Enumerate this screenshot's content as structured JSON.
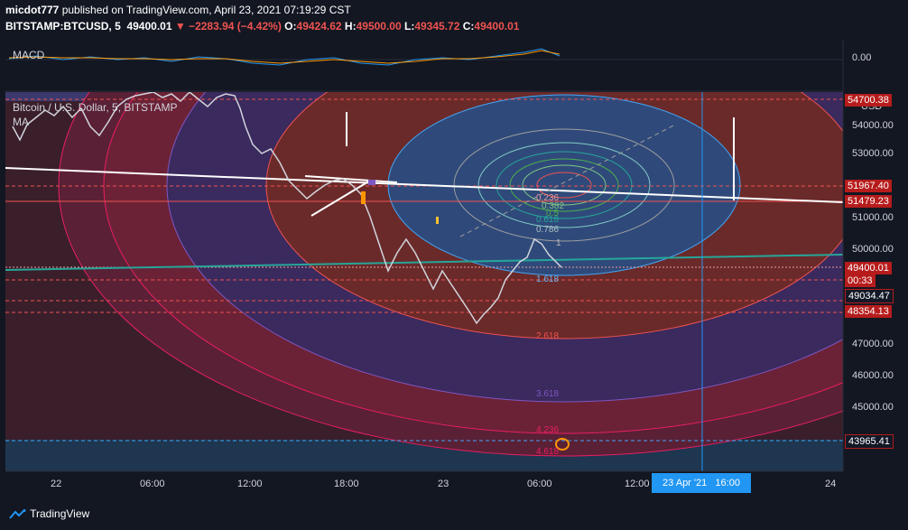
{
  "header": {
    "publisher": "micdot777",
    "published_text": "published on TradingView.com, April 23, 2021 07:19:29 CST",
    "symbol": "BITSTAMP:BTCUSD, 5",
    "last": "49400.01",
    "change": "▼ −2283.94 (−4.42%)",
    "o_label": "O:",
    "o_val": "49424.62",
    "h_label": "H:",
    "h_val": "49500.00",
    "l_label": "L:",
    "l_val": "49345.72",
    "c_label": "C:",
    "c_val": "49400.01"
  },
  "macd": {
    "label": "MACD",
    "zero": "0.00"
  },
  "chart_title": "Bitcoin / U.S. Dollar, 5, BITSTAMP",
  "ma_label": "MA",
  "currency": "USD",
  "price_axis": [
    "54000.00",
    "53000.00",
    "52000.00",
    "51000.00",
    "50000.00",
    "47000.00",
    "46000.00",
    "45000.00"
  ],
  "price_tags": [
    {
      "value": "54700.38",
      "dark": false
    },
    {
      "value": "51967.40",
      "dark": false
    },
    {
      "value": "51479.23",
      "dark": false
    },
    {
      "value": "49400.01",
      "dark": false
    },
    {
      "value": "00:33",
      "dark": false
    },
    {
      "value": "49034.47",
      "dark": true
    },
    {
      "value": "48354.13",
      "dark": false
    },
    {
      "value": "43965.41",
      "dark": true
    }
  ],
  "time_axis": [
    "22",
    "06:00",
    "12:00",
    "18:00",
    "23",
    "06:00",
    "12:00",
    "24"
  ],
  "cursor_date": "23 Apr '21",
  "cursor_time": "16:00",
  "fib_levels": [
    "0.236",
    "0.382",
    "0.5",
    "0.618",
    "0.786",
    "1",
    "1.618",
    "2.618",
    "3.618",
    "4.236",
    "4.618"
  ],
  "colors": {
    "background": "#131722",
    "red": "#ef5350",
    "tag": "#b71c1c",
    "blue": "#2196f3"
  },
  "brand": "TradingView"
}
